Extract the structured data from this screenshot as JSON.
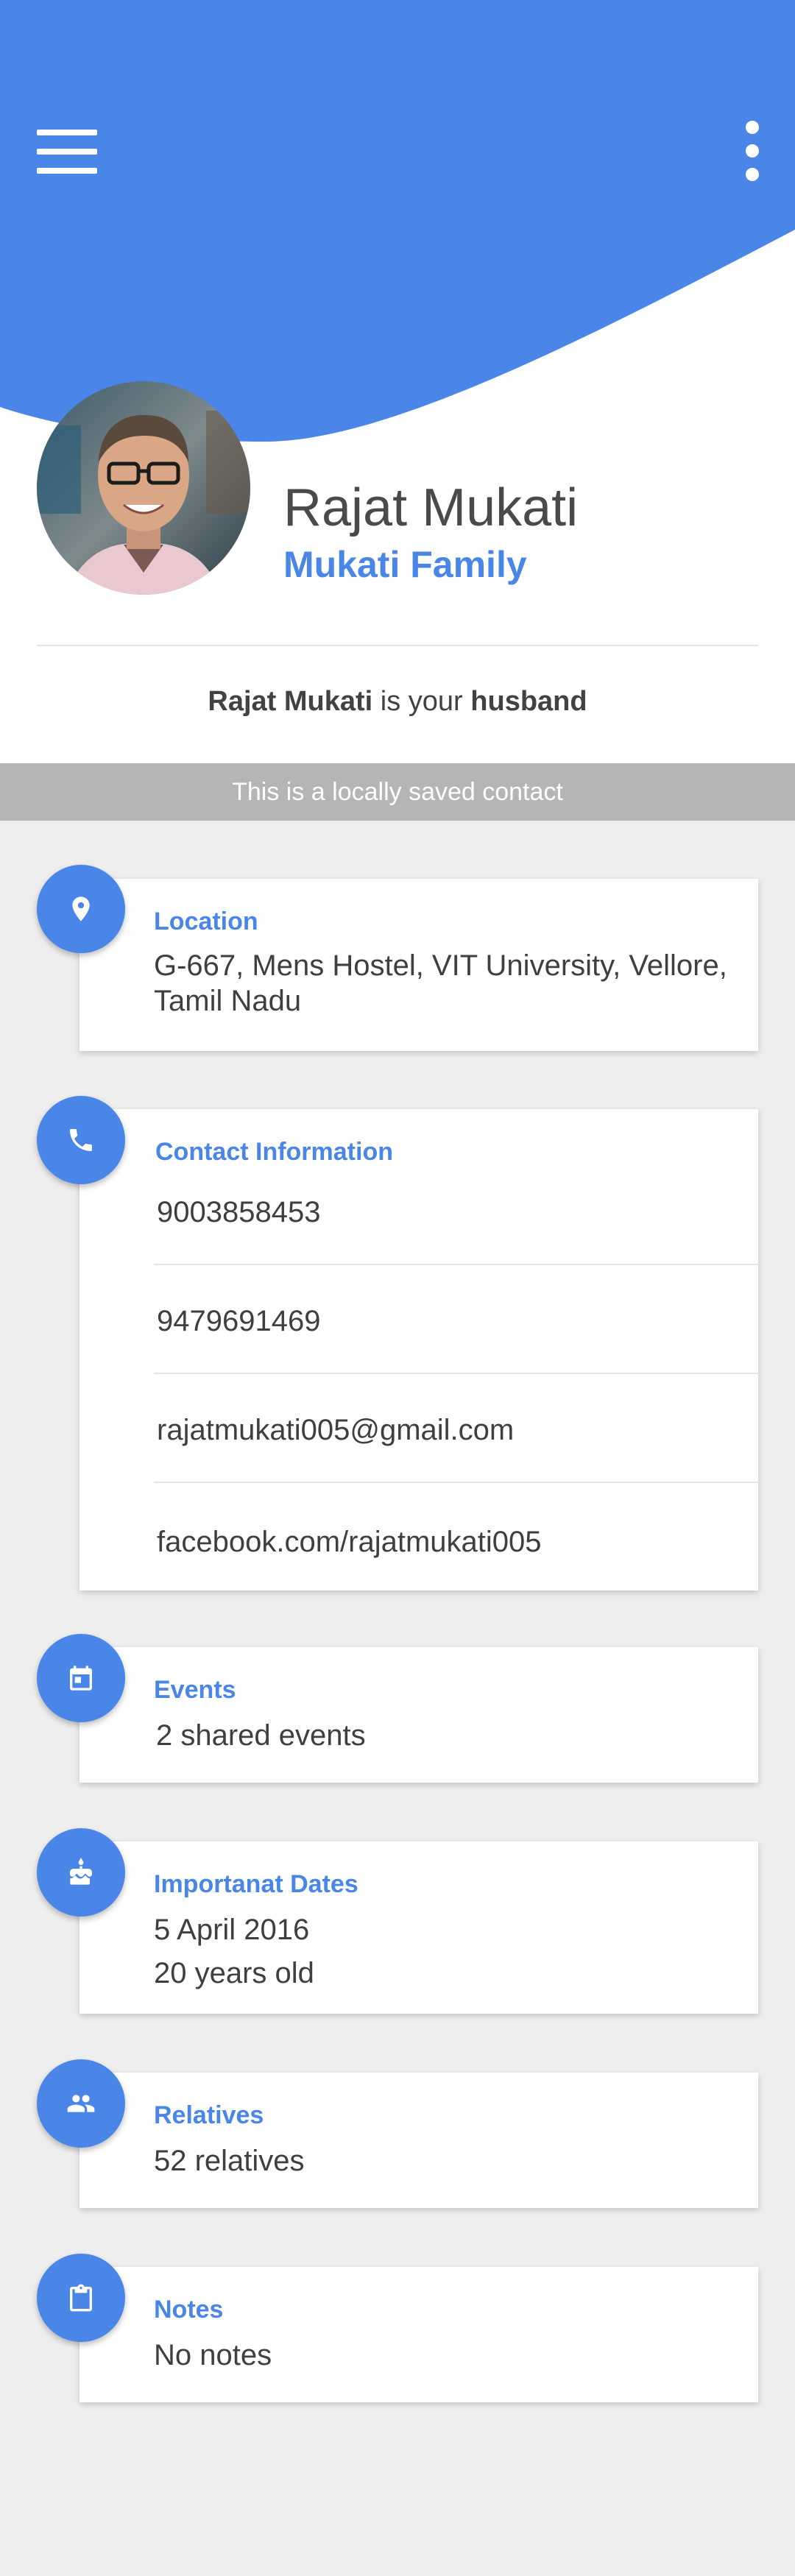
{
  "colors": {
    "accent": "#4a86e8",
    "background": "#efeeef",
    "banner": "#b5b5b5"
  },
  "header": {
    "menu_icon": "hamburger-menu-icon",
    "more_icon": "vertical-more-icon"
  },
  "profile": {
    "name": "Rajat Mukati",
    "family": "Mukati Family",
    "relation": {
      "name": "Rajat Mukati",
      "middle": " is your ",
      "role": "husband"
    }
  },
  "banner": {
    "text": "This is a locally saved contact"
  },
  "cards": {
    "location": {
      "icon": "location-pin-icon",
      "title": "Location",
      "line1": "G-667, Mens Hostel, VIT University, Vellore,",
      "line2": "Tamil Nadu"
    },
    "contact": {
      "icon": "phone-icon",
      "title": "Contact Information",
      "items": [
        "9003858453",
        "9479691469",
        "rajatmukati005@gmail.com",
        "facebook.com/rajatmukati005"
      ]
    },
    "events": {
      "icon": "calendar-icon",
      "title": "Events",
      "text": "2 shared events"
    },
    "dates": {
      "icon": "cake-icon",
      "title": "Importanat Dates",
      "line1": "5 April 2016",
      "line2": "20 years old"
    },
    "relatives": {
      "icon": "people-icon",
      "title": "Relatives",
      "text": "52 relatives"
    },
    "notes": {
      "icon": "clipboard-icon",
      "title": "Notes",
      "text": "No notes"
    }
  }
}
